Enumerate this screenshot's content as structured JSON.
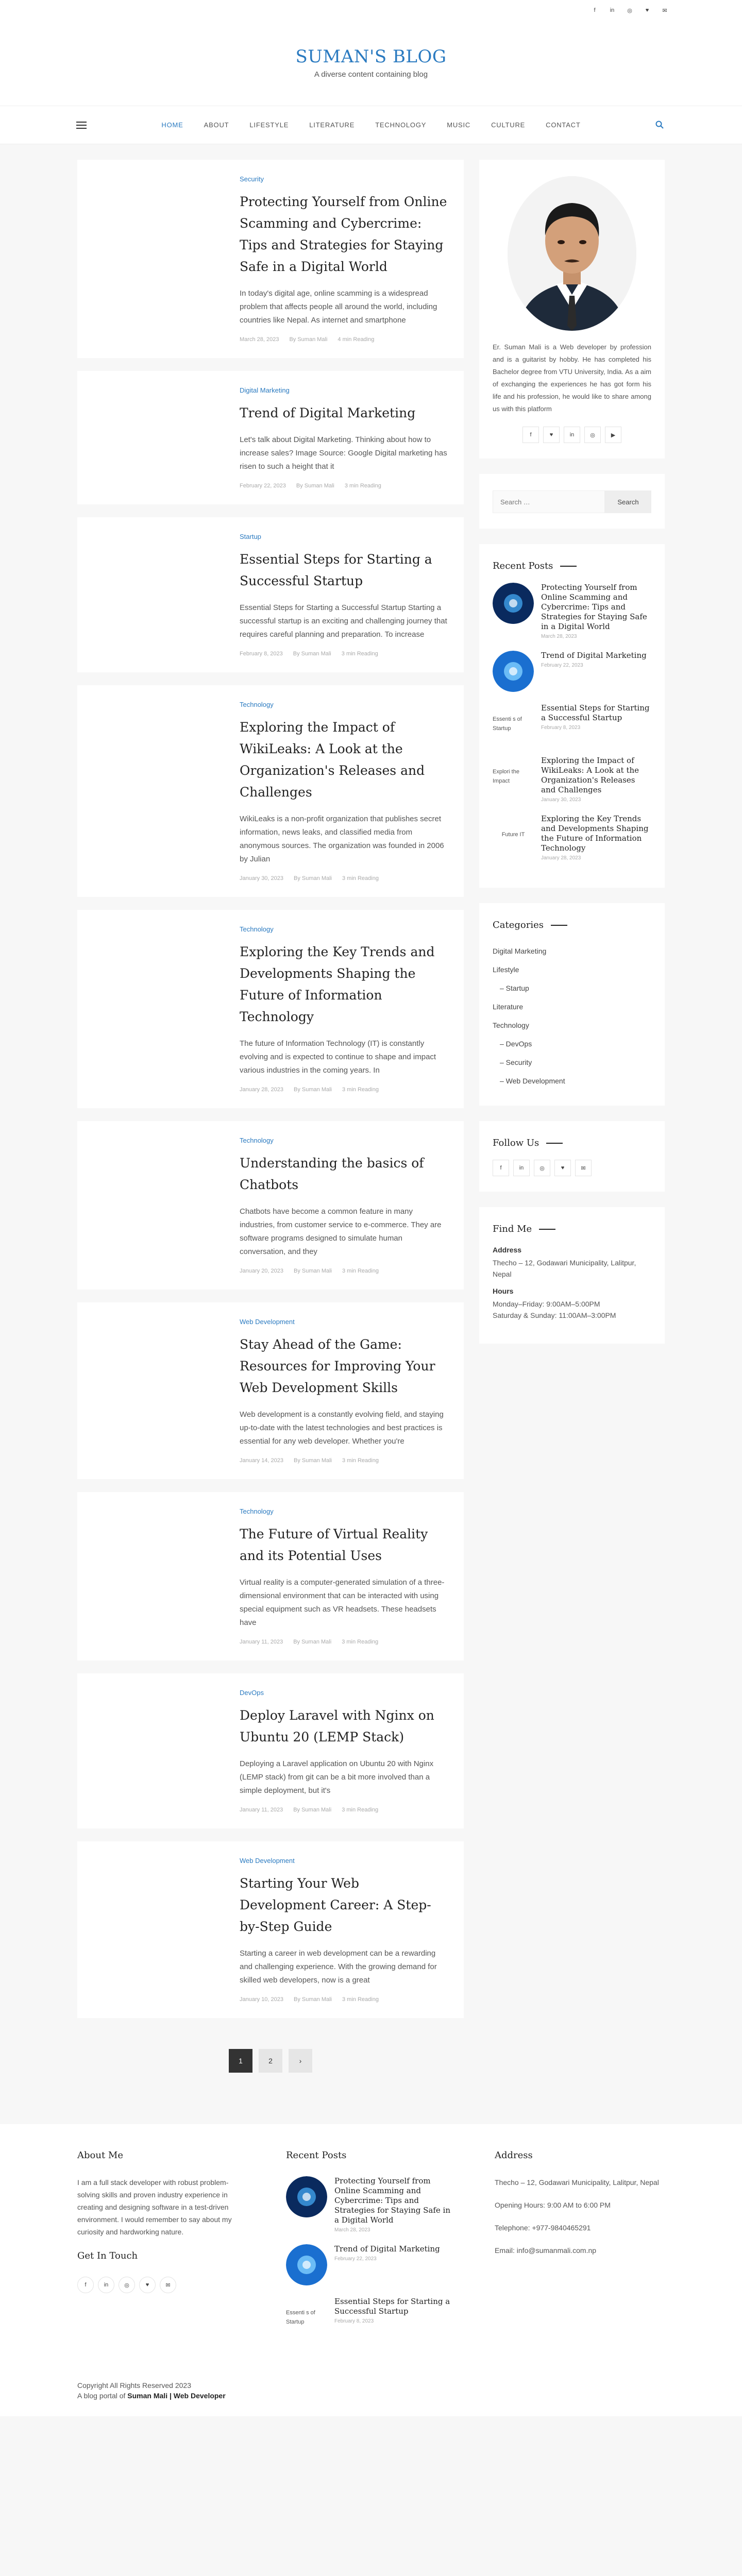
{
  "topbar": {
    "social_icons": [
      "facebook-icon",
      "linkedin-icon",
      "instagram-icon",
      "twitter-icon",
      "mail-icon"
    ],
    "glyphs": [
      "f",
      "in",
      "◎",
      "♥",
      "✉"
    ]
  },
  "header": {
    "title": "SUMAN'S BLOG",
    "tagline": "A diverse content containing blog"
  },
  "nav": {
    "items": [
      "HOME",
      "ABOUT",
      "LIFESTYLE",
      "LITERATURE",
      "TECHNOLOGY",
      "MUSIC",
      "CULTURE",
      "CONTACT"
    ],
    "active": "HOME"
  },
  "posts": [
    {
      "category": "Security",
      "title": "Protecting Yourself from Online Scamming and Cybercrime: Tips and Strategies for Staying Safe in a Digital World",
      "excerpt": "In today's digital age, online scamming is a widespread problem that affects people all around the world, including countries like Nepal. As internet and smartphone",
      "date": "March 28, 2023",
      "author": "By Suman Mali",
      "read": "4 min Reading"
    },
    {
      "category": "Digital Marketing",
      "title": "Trend of Digital Marketing",
      "excerpt": "Let's talk about Digital Marketing. Thinking about how to increase sales? Image Source: Google Digital marketing has risen to such a height that it",
      "date": "February 22, 2023",
      "author": "By Suman Mali",
      "read": "3 min Reading"
    },
    {
      "category": "Startup",
      "title": "Essential Steps for Starting a Successful Startup",
      "excerpt": "Essential Steps for Starting a Successful Startup Starting a successful startup is an exciting and challenging journey that requires careful planning and preparation. To increase",
      "date": "February 8, 2023",
      "author": "By Suman Mali",
      "read": "3 min Reading"
    },
    {
      "category": "Technology",
      "title": "Exploring the Impact of WikiLeaks: A Look at the Organization's Releases and Challenges",
      "excerpt": "WikiLeaks is a non-profit organization that publishes secret information, news leaks, and classified media from anonymous sources. The organization was founded in 2006 by Julian",
      "date": "January 30, 2023",
      "author": "By Suman Mali",
      "read": "3 min Reading"
    },
    {
      "category": "Technology",
      "title": "Exploring the Key Trends and Developments Shaping the Future of Information Technology",
      "excerpt": "The future of Information Technology (IT) is constantly evolving and is expected to continue to shape and impact various industries in the coming years. In",
      "date": "January 28, 2023",
      "author": "By Suman Mali",
      "read": "3 min Reading"
    },
    {
      "category": "Technology",
      "title": "Understanding the basics of Chatbots",
      "excerpt": "Chatbots have become a common feature in many industries, from customer service to e-commerce. They are software programs designed to simulate human conversation, and they",
      "date": "January 20, 2023",
      "author": "By Suman Mali",
      "read": "3 min Reading"
    },
    {
      "category": "Web Development",
      "title": "Stay Ahead of the Game: Resources for Improving Your Web Development Skills",
      "excerpt": "Web development is a constantly evolving field, and staying up-to-date with the latest technologies and best practices is essential for any web developer. Whether you're",
      "date": "January 14, 2023",
      "author": "By Suman Mali",
      "read": "3 min Reading"
    },
    {
      "category": "Technology",
      "title": "The Future of Virtual Reality and its Potential Uses",
      "excerpt": "Virtual reality is a computer-generated simulation of a three-dimensional environment that can be interacted with using special equipment such as VR headsets. These headsets have",
      "date": "January 11, 2023",
      "author": "By Suman Mali",
      "read": "3 min Reading"
    },
    {
      "category": "DevOps",
      "title": "Deploy Laravel with Nginx on Ubuntu 20 (LEMP Stack)",
      "excerpt": "Deploying a Laravel application on Ubuntu 20 with Nginx (LEMP stack) from git can be a bit more involved than a simple deployment, but it's",
      "date": "January 11, 2023",
      "author": "By Suman Mali",
      "read": "3 min Reading"
    },
    {
      "category": "Web Development",
      "title": "Starting Your Web Development Career: A Step-by-Step Guide",
      "excerpt": "Starting a career in web development can be a rewarding and challenging experience. With the growing demand for skilled web developers, now is a great",
      "date": "January 10, 2023",
      "author": "By Suman Mali",
      "read": "3 min Reading"
    }
  ],
  "pagination": {
    "pages": [
      "1",
      "2",
      "›"
    ],
    "current": "1"
  },
  "sidebar": {
    "about_text": "Er. Suman Mali is a Web developer by profession and is a guitarist by hobby. He has completed his Bachelor degree from VTU University, India. As a aim of exchanging the experiences he has got form his life and his profession, he would like to share among us with this platform",
    "search": {
      "placeholder": "Search …",
      "button": "Search"
    },
    "recent_title": "Recent Posts",
    "recent": [
      {
        "title": "Protecting Yourself from Online Scamming and Cybercrime: Tips and Strategies for Staying Safe in a Digital World",
        "date": "March 28, 2023",
        "thumb": "image"
      },
      {
        "title": "Trend of Digital Marketing",
        "date": "February 22, 2023",
        "thumb": "image"
      },
      {
        "title": "Essential Steps for Starting a Successful Startup",
        "date": "February 8, 2023",
        "thumb": "Essenti s of Startup"
      },
      {
        "title": "Exploring the Impact of WikiLeaks: A Look at the Organization's Releases and Challenges",
        "date": "January 30, 2023",
        "thumb": "Explori the Impact"
      },
      {
        "title": "Exploring the Key Trends and Developments Shaping the Future of Information Technology",
        "date": "January 28, 2023",
        "thumb": "Future IT"
      }
    ],
    "categories_title": "Categories",
    "categories": [
      {
        "label": "Digital Marketing",
        "sub": false
      },
      {
        "label": "Lifestyle",
        "sub": false
      },
      {
        "label": "– Startup",
        "sub": true
      },
      {
        "label": "Literature",
        "sub": false
      },
      {
        "label": "Technology",
        "sub": false
      },
      {
        "label": "– DevOps",
        "sub": true
      },
      {
        "label": "– Security",
        "sub": true
      },
      {
        "label": "– Web Development",
        "sub": true
      }
    ],
    "follow_title": "Follow Us",
    "find_title": "Find Me",
    "address_label": "Address",
    "address": "Thecho – 12, Godawari Municipality, Lalitpur, Nepal",
    "hours_label": "Hours",
    "hours_1": "Monday–Friday: 9:00AM–5:00PM",
    "hours_2": "Saturday & Sunday: 11:00AM–3:00PM"
  },
  "footer": {
    "about_title": "About Me",
    "about_text": "I am a full stack developer with robust problem-solving skills and proven industry experience in creating and designing software in a test-driven environment. I would remember to say about my curiosity and hardworking nature.",
    "touch_title": "Get In Touch",
    "recent_title": "Recent Posts",
    "address_title": "Address",
    "address": "Thecho – 12, Godawari Municipality, Lalitpur, Nepal",
    "opening": "Opening Hours: 9:00 AM to 6:00 PM",
    "phone": "Telephone: +977-9840465291",
    "email": "Email: info@sumanmali.com.np",
    "copyright": "Copyright All Rights Reserved 2023",
    "portal_prefix": "A blog portal of",
    "portal_name": "Suman Mali | Web Developer"
  },
  "colors": {
    "accent": "#2a7ac0",
    "dark": "#333333",
    "background": "#f7f7f7"
  }
}
